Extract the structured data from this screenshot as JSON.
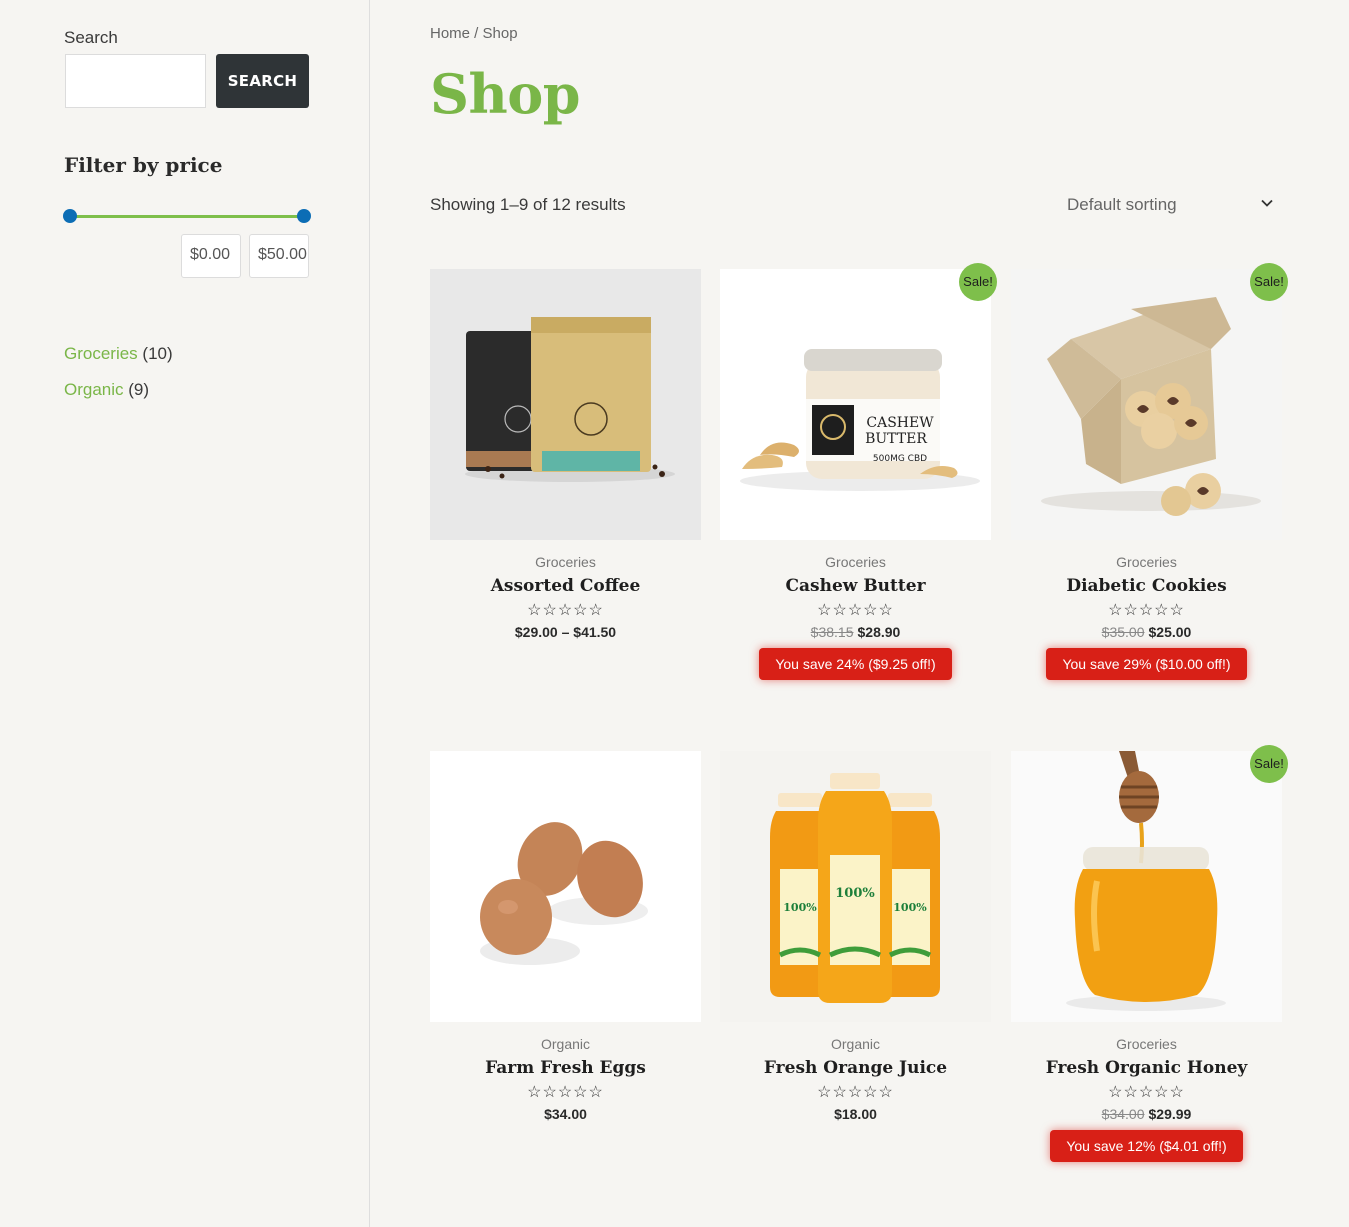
{
  "sidebar": {
    "search_label": "Search",
    "search_placeholder": "",
    "search_button": "SEARCH",
    "filter_title": "Filter by price",
    "price_min": "$0.00",
    "price_max": "$50.00",
    "categories": [
      {
        "name": "Groceries",
        "count": "(10)"
      },
      {
        "name": "Organic",
        "count": "(9)"
      }
    ]
  },
  "main": {
    "breadcrumb": "Home / Shop",
    "title": "Shop",
    "result_count": "Showing 1–9 of 12 results",
    "sorting": "Default sorting"
  },
  "products": [
    {
      "category": "Groceries",
      "name": "Assorted Coffee",
      "stars": "☆☆☆☆☆",
      "price": "$29.00 – $41.50",
      "old_price": "",
      "savings": "",
      "sale": ""
    },
    {
      "category": "Groceries",
      "name": "Cashew Butter",
      "stars": "☆☆☆☆☆",
      "price": "$28.90",
      "old_price": "$38.15",
      "savings": "You save 24% ($9.25 off!)",
      "sale": "Sale!"
    },
    {
      "category": "Groceries",
      "name": "Diabetic Cookies",
      "stars": "☆☆☆☆☆",
      "price": "$25.00",
      "old_price": "$35.00",
      "savings": "You save 29% ($10.00 off!)",
      "sale": "Sale!"
    },
    {
      "category": "Organic",
      "name": "Farm Fresh Eggs",
      "stars": "☆☆☆☆☆",
      "price": "$34.00",
      "old_price": "",
      "savings": "",
      "sale": ""
    },
    {
      "category": "Organic",
      "name": "Fresh Orange Juice",
      "stars": "☆☆☆☆☆",
      "price": "$18.00",
      "old_price": "",
      "savings": "",
      "sale": ""
    },
    {
      "category": "Groceries",
      "name": "Fresh Organic Honey",
      "stars": "☆☆☆☆☆",
      "price": "$29.99",
      "old_price": "$34.00",
      "savings": "You save 12% ($4.01 off!)",
      "sale": "Sale!"
    }
  ],
  "icons": {
    "sort": "chevron-down-icon",
    "rating": "star-outline-icon"
  },
  "colors": {
    "accent_green": "#7ab648",
    "sale_red": "#d82017",
    "slider_blue": "#0c6db5",
    "button_dark": "#2f3437"
  }
}
